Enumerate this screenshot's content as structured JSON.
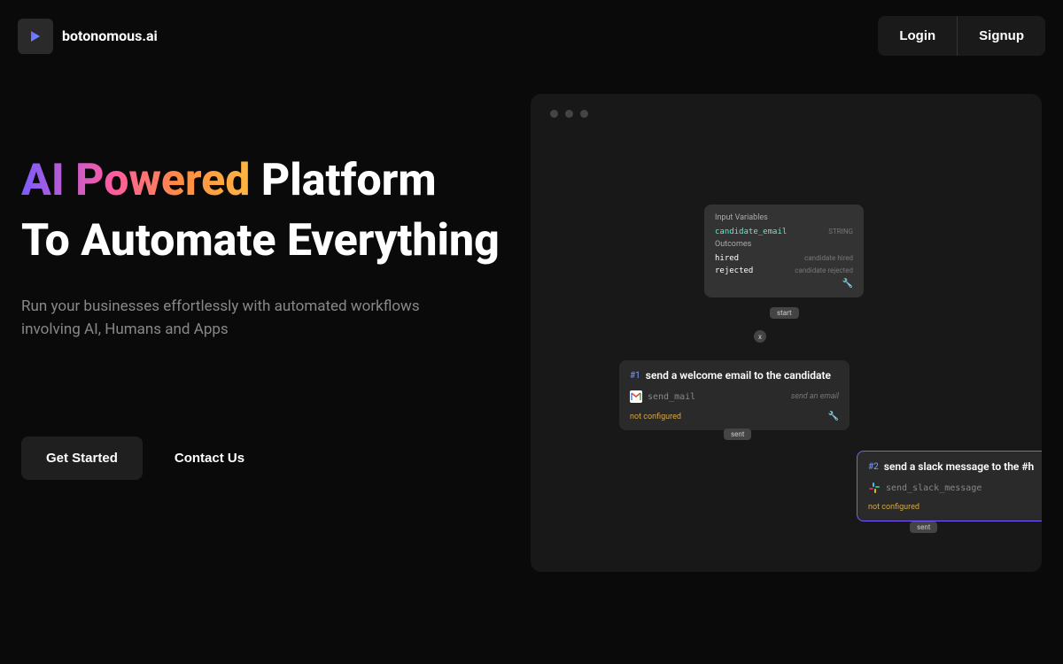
{
  "header": {
    "brand": "botonomous.ai",
    "login": "Login",
    "signup": "Signup"
  },
  "hero": {
    "title_gradient": "AI Powered",
    "title_rest": " Platform",
    "title_line2": "To Automate Everything",
    "subtitle": "Run your businesses effortlessly with automated workflows involving AI, Humans and Apps",
    "cta_primary": "Get Started",
    "cta_secondary": "Contact Us"
  },
  "workflow": {
    "input_variables_label": "Input Variables",
    "var1_name": "candidate_email",
    "var1_type": "STRING",
    "outcomes_label": "Outcomes",
    "outcome1_name": "hired",
    "outcome1_desc": "candidate hired",
    "outcome2_name": "rejected",
    "outcome2_desc": "candidate rejected",
    "start_tag": "start",
    "x_tag": "x",
    "step1_num": "#1",
    "step1_title": "send a welcome email to the candidate",
    "step1_app": "send_mail",
    "step1_action": "send an email",
    "step1_status": "not configured",
    "step2_num": "#2",
    "step2_title": "send a slack message to the #h",
    "step2_app": "send_slack_message",
    "step2_status": "not configured",
    "sent_tag": "sent"
  }
}
